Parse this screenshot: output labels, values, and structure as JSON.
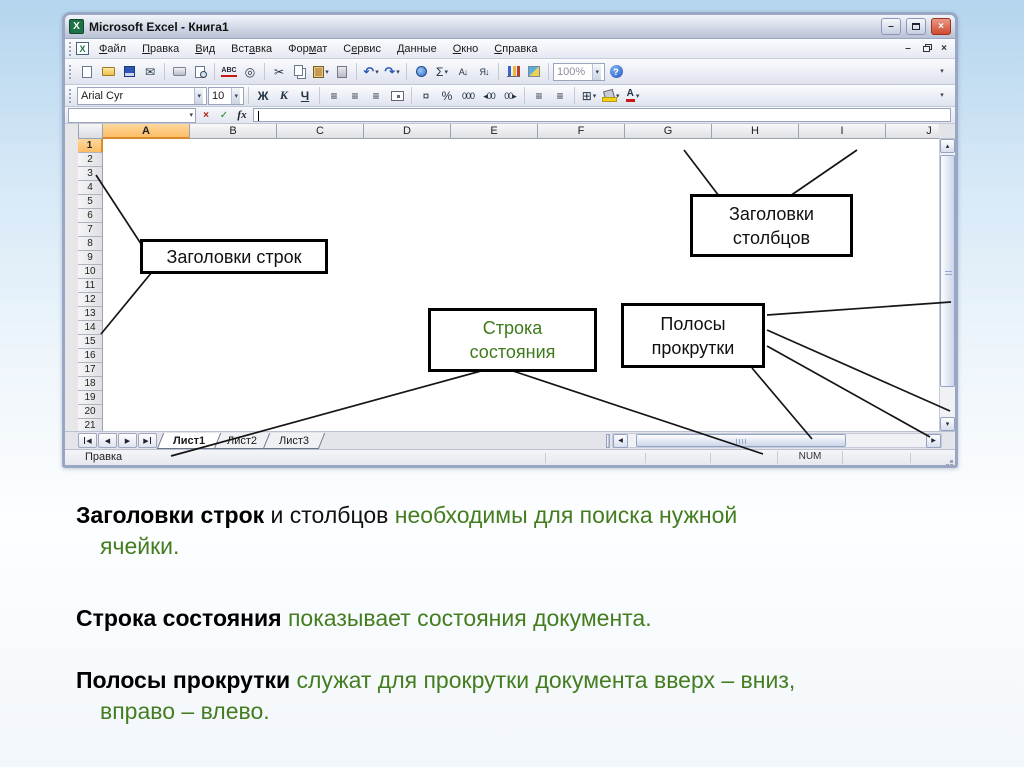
{
  "window": {
    "title": "Microsoft Excel - Книга1",
    "menu": [
      {
        "label": "Файл",
        "u": 0
      },
      {
        "label": "Правка",
        "u": 0
      },
      {
        "label": "Вид",
        "u": 0
      },
      {
        "label": "Вставка",
        "u": 3
      },
      {
        "label": "Формат",
        "u": 3
      },
      {
        "label": "Сервис",
        "u": 1
      },
      {
        "label": "Данные",
        "u": 0
      },
      {
        "label": "Окно",
        "u": 0
      },
      {
        "label": "Справка",
        "u": 0
      }
    ],
    "font_name": "Arial Cyr",
    "font_size": "10",
    "zoom": "100%",
    "columns": [
      "A",
      "B",
      "C",
      "D",
      "E",
      "F",
      "G",
      "H",
      "I",
      "J"
    ],
    "selected_column": "A",
    "rows": [
      "1",
      "2",
      "3",
      "4",
      "5",
      "6",
      "7",
      "8",
      "9",
      "10",
      "11",
      "12",
      "13",
      "14",
      "15",
      "16",
      "17",
      "18",
      "19",
      "20",
      "21"
    ],
    "selected_row": "1",
    "sheets": [
      "Лист1",
      "Лист2",
      "Лист3"
    ],
    "active_sheet": "Лист1",
    "status_left": "Правка",
    "status_num": "NUM"
  },
  "icons": {
    "dropdown": "▾",
    "up": "▴",
    "down": "▾",
    "left": "◀",
    "right": "▶",
    "minimize": "–",
    "close": "×",
    "mail": "✉",
    "spelling": "ABC",
    "research": "◎",
    "cut": "✂",
    "undo": "↶",
    "redo": "↷",
    "autosum": "Σ",
    "sort_asc": "А↓",
    "sort_desc": "Я↓",
    "help": "?",
    "bold": "Ж",
    "italic": "К",
    "underline": "Ч",
    "align": "≡",
    "currency": "¤",
    "percent": "%",
    "zeros": "000",
    "inc_decimal": "◂00",
    "dec_decimal": "00▸",
    "borders": "⊞",
    "font_color": "А",
    "name_dropdown": "▾",
    "cancel": "×",
    "enter": "✓",
    "fx": "fx",
    "resize_grip": "⋰"
  },
  "callouts": {
    "rows": "Заголовки строк",
    "cols_line1": "Заголовки",
    "cols_line2": "столбцов",
    "status_line1": "Строка",
    "status_line2": "состояния",
    "scroll_line1": "Полосы",
    "scroll_line2": "прокрутки"
  },
  "slide": {
    "paragraphs": [
      {
        "lead": "Заголовки строк",
        "mid": " и столбцов ",
        "rest": "необходимы для поиска нужной\nячейки."
      },
      {
        "lead": "Строка состояния",
        "mid": " ",
        "rest": "показывает состояния документа."
      },
      {
        "lead": "Полосы прокрутки",
        "mid": " ",
        "rest": "служат для прокрутки документа вверх – вниз,\nвправо – влево."
      }
    ],
    "colors": {
      "green_text": "#447d1f",
      "header_highlight": "#fbbd66",
      "callout_border": "#000000"
    }
  }
}
